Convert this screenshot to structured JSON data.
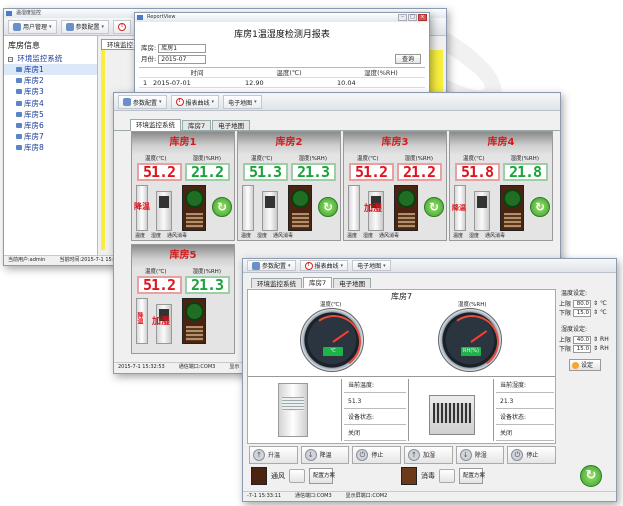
{
  "w1": {
    "title": "温湿度监控",
    "toolbar": {
      "user_mgmt": "用户管理",
      "params": "参数配置"
    },
    "sidebar": {
      "title": "库房信息",
      "root": "环境监控系统",
      "items": [
        "库房1",
        "库房2",
        "库房3",
        "库房4",
        "库房5",
        "库房6",
        "库房7",
        "库房8"
      ]
    },
    "tab": "环境监控系统",
    "status": {
      "user": "当前用户:admin",
      "time": "当前时间:2015-7-1 15:"
    }
  },
  "report": {
    "window_title": "ReportView",
    "heading": "库房1温湿度检测月报表",
    "warehouse_label": "库房:",
    "warehouse_value": "库房1",
    "month_label": "月份:",
    "month_value": "2015-07",
    "query": "查询",
    "columns": [
      "",
      "时间",
      "温度(℃)",
      "湿度(%RH)"
    ],
    "rows": [
      [
        "1",
        "2015-07-01",
        "12.90",
        "10.04"
      ]
    ]
  },
  "w2": {
    "toolbar": {
      "params": "参数配置",
      "curve": "报表曲线",
      "map": "电子地图"
    },
    "tabs": [
      "环境监控系统",
      "库房7",
      "电子地图"
    ],
    "temp_label": "温度(℃)",
    "hum_label": "湿度(%RH)",
    "captions": [
      "温度",
      "湿度",
      "通风消毒"
    ],
    "rooms": [
      {
        "name": "库房1",
        "temp": "51.2",
        "hum": "21.2",
        "warn": "降温"
      },
      {
        "name": "库房2",
        "temp": "51.3",
        "hum": "21.3",
        "warn": ""
      },
      {
        "name": "库房3",
        "temp": "51.2",
        "hum": "21.2",
        "warn": "加湿"
      },
      {
        "name": "库房4",
        "temp": "51.8",
        "hum": "21.8",
        "warn": "降温"
      },
      {
        "name": "库房5",
        "temp": "51.2",
        "hum": "21.3",
        "warn": "降温",
        "warn2": "加湿"
      }
    ],
    "status": {
      "time": "2015-7-1 15:32:53",
      "port": "通信端口:COM3",
      "extra": "显示"
    }
  },
  "w3": {
    "toolbar": {
      "params": "参数配置",
      "curve": "报表曲线",
      "map": "电子地图"
    },
    "tabs": [
      "环境监控系统",
      "库房7",
      "电子地图"
    ],
    "title": "库房7",
    "temp_gauge_label": "温度(℃)",
    "hum_gauge_label": "湿度(%RH)",
    "temp_gauge_unit": "℃",
    "hum_gauge_unit": "RH(%)",
    "cur_temp_label": "当前温度:",
    "cur_temp_value": "51.3",
    "cur_hum_label": "当前湿度:",
    "cur_hum_value": "21.3",
    "dev_state_label": "设备状态:",
    "dev_state_ac": "关闭",
    "dev_state_dh": "关闭",
    "controls": [
      "升温",
      "降温",
      "停止",
      "加湿",
      "除湿",
      "停止"
    ],
    "vent": "通风",
    "disinfect": "消毒",
    "config_plan": "配置方案",
    "settings": {
      "temp_title": "温度设定:",
      "hum_title": "湿度设定:",
      "upper": "上限",
      "lower": "下限",
      "temp_upper": "80.0",
      "temp_lower": "15.0",
      "temp_unit": "℃",
      "hum_upper": "40.0",
      "hum_lower": "15.0",
      "hum_unit": "RH",
      "apply": "设定"
    },
    "status": {
      "time": "-7-1 15:33:11",
      "port": "通信端口:COM3",
      "display_port": "显示屏端口:COM2"
    }
  }
}
